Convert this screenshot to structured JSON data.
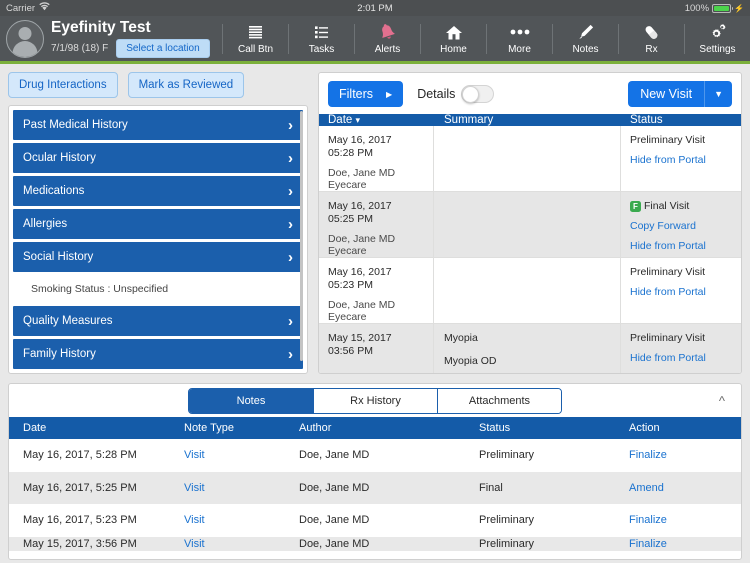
{
  "status_bar": {
    "carrier": "Carrier",
    "wifi_icon": "wifi-icon",
    "time": "2:01 PM",
    "battery_percent": "100%",
    "battery_icon": "battery-full-icon",
    "charging_icon": "lightning-bolt-icon"
  },
  "header": {
    "avatar_icon": "person-avatar-icon",
    "patient_name": "Eyefinity Test",
    "patient_dob": "7/1/98 (18) F",
    "location_button": "Select a location",
    "nav": [
      {
        "label": "Call Btn",
        "icon": "lines-list-icon"
      },
      {
        "label": "Tasks",
        "icon": "tasks-checklist-icon"
      },
      {
        "label": "Alerts",
        "icon": "bell-icon"
      },
      {
        "label": "Home",
        "icon": "house-icon"
      },
      {
        "label": "More",
        "icon": "ellipsis-icon"
      },
      {
        "label": "Notes",
        "icon": "pen-nib-icon"
      },
      {
        "label": "Rx",
        "icon": "pill-capsule-icon"
      },
      {
        "label": "Settings",
        "icon": "gears-icon"
      }
    ]
  },
  "left_panel": {
    "buttons": [
      {
        "label": "Drug Interactions"
      },
      {
        "label": "Mark as Reviewed"
      }
    ],
    "accordion": [
      {
        "label": "Past Medical History",
        "type": "section"
      },
      {
        "label": "Ocular History",
        "type": "section"
      },
      {
        "label": "Medications",
        "type": "section"
      },
      {
        "label": "Allergies",
        "type": "section"
      },
      {
        "label": "Social History",
        "type": "section"
      },
      {
        "label": "Smoking Status : Unspecified",
        "type": "detail"
      },
      {
        "label": "Quality Measures",
        "type": "section"
      },
      {
        "label": "Family History",
        "type": "section"
      }
    ]
  },
  "visits_panel": {
    "filters_button": "Filters",
    "filters_arrow_icon": "triangle-right-icon",
    "details_label": "Details",
    "details_toggle_state": "off",
    "new_visit_button": "New Visit",
    "new_visit_dropdown_icon": "chevron-down-icon",
    "columns": [
      "Date",
      "Summary",
      "Status"
    ],
    "sort_icon": "chevron-down-icon",
    "rows": [
      {
        "date": "May 16, 2017",
        "time": "05:28 PM",
        "provider": "Doe, Jane MD",
        "practice": "Eyecare",
        "summary": [],
        "status": "Preliminary Visit",
        "badge": "",
        "actions": [
          "Hide from Portal"
        ]
      },
      {
        "date": "May 16, 2017",
        "time": "05:25 PM",
        "provider": "Doe, Jane MD",
        "practice": "Eyecare",
        "summary": [],
        "status": "Final Visit",
        "badge": "F",
        "actions": [
          "Copy Forward",
          "Hide from Portal"
        ]
      },
      {
        "date": "May 16, 2017",
        "time": "05:23 PM",
        "provider": "Doe, Jane MD",
        "practice": "Eyecare",
        "summary": [],
        "status": "Preliminary Visit",
        "badge": "",
        "actions": [
          "Hide from Portal"
        ]
      },
      {
        "date": "May 15, 2017",
        "time": "03:56 PM",
        "provider": "",
        "practice": "",
        "summary": [
          "Myopia",
          "Myopia OD"
        ],
        "status": "Preliminary Visit",
        "badge": "",
        "actions": [
          "Hide from Portal"
        ]
      }
    ]
  },
  "notes_panel": {
    "tabs": [
      {
        "label": "Notes",
        "active": true
      },
      {
        "label": "Rx History",
        "active": false
      },
      {
        "label": "Attachments",
        "active": false
      }
    ],
    "collapse_icon": "chevron-up-icon",
    "columns": [
      "Date",
      "Note Type",
      "Author",
      "Status",
      "Action"
    ],
    "rows": [
      {
        "date": "May 16, 2017, 5:28 PM",
        "note_type": "Visit",
        "author": "Doe, Jane MD",
        "status": "Preliminary",
        "action": "Finalize"
      },
      {
        "date": "May 16, 2017, 5:25 PM",
        "note_type": "Visit",
        "author": "Doe, Jane MD",
        "status": "Final",
        "action": "Amend"
      },
      {
        "date": "May 16, 2017, 5:23 PM",
        "note_type": "Visit",
        "author": "Doe, Jane MD",
        "status": "Preliminary",
        "action": "Finalize"
      },
      {
        "date": "May 15, 2017, 3:56 PM",
        "note_type": "Visit",
        "author": "Doe, Jane MD",
        "status": "Preliminary",
        "action": "Finalize"
      }
    ]
  },
  "colors": {
    "brand_blue": "#1b5fac",
    "accent_blue": "#1473e6",
    "link_blue": "#1a72cf",
    "green_rule": "#7bb03b",
    "header_gray": "#515558",
    "final_badge_green": "#3aaa4f"
  }
}
